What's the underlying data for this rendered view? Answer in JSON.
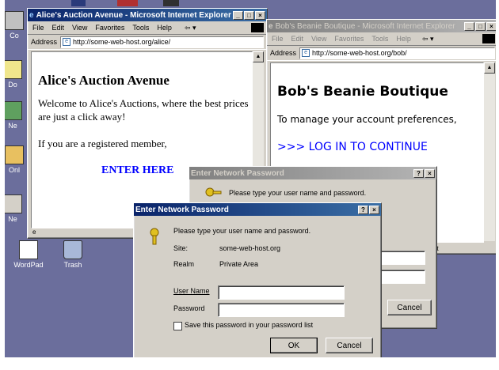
{
  "desktop": {
    "icons": [
      {
        "label": "Co",
        "name": "computer-icon"
      },
      {
        "label": "Do",
        "name": "documents-icon"
      },
      {
        "label": "Ne",
        "name": "network-icon"
      },
      {
        "label": "Onl",
        "name": "online-services-icon"
      },
      {
        "label": "Ne",
        "name": "network-icon-2"
      },
      {
        "label": "WordPad",
        "name": "wordpad-icon"
      },
      {
        "label": "Trash",
        "name": "trash-icon"
      }
    ]
  },
  "alice": {
    "title": "Alice's Auction Avenue - Microsoft Internet Explorer",
    "menu": [
      "File",
      "Edit",
      "View",
      "Favorites",
      "Tools",
      "Help"
    ],
    "address_label": "Address",
    "url": "http://some-web-host.org/alice/",
    "heading": "Alice's Auction Avenue",
    "welcome": "Welcome to Alice's Auctions, where the best prices are just a click away!",
    "member": "If you are a registered member,",
    "link": "ENTER HERE"
  },
  "bob": {
    "title": "Bob's Beanie Boutique - Microsoft Internet Explorer",
    "menu": [
      "File",
      "Edit",
      "View",
      "Favorites",
      "Tools",
      "Help"
    ],
    "address_label": "Address",
    "url": "http://some-web-host.org/bob/",
    "heading": "Bob's Beanie Boutique",
    "manage": "To manage your account preferences,",
    "link": ">>> LOG IN TO CONTINUE",
    "status_tail": "et"
  },
  "dialog_back": {
    "title": "Enter Network Password",
    "prompt": "Please type your user name and password.",
    "cancel": "Cancel"
  },
  "dialog_front": {
    "title": "Enter Network Password",
    "prompt": "Please type your user name and password.",
    "site_label": "Site:",
    "site_value": "some-web-host.org",
    "realm_label": "Realm",
    "realm_value": "Private Area",
    "username_label": "User Name",
    "password_label": "Password",
    "save_label": "Save this password in your password list",
    "ok": "OK",
    "cancel": "Cancel"
  },
  "colors": {
    "desktop": "#6b6e9c",
    "title_active": "#0a246a",
    "link": "#0000ff"
  }
}
